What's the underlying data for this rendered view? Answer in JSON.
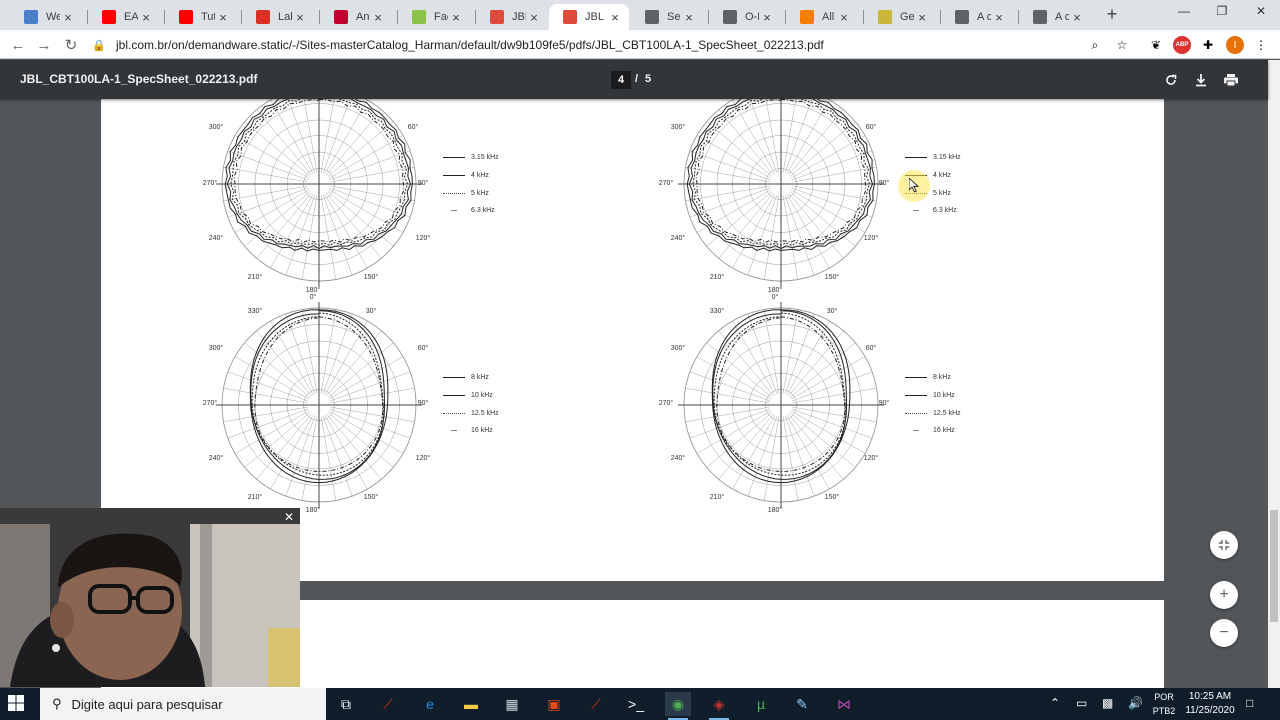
{
  "browser": {
    "tabs": [
      {
        "title": "Welti",
        "icon": "doc-icon",
        "color": "#4a7ec9"
      },
      {
        "title": "EASE",
        "icon": "youtube-icon",
        "color": "#ff0000"
      },
      {
        "title": "Tutor",
        "icon": "youtube-icon",
        "color": "#ff0000"
      },
      {
        "title": "Lab N",
        "icon": "red-shape-icon",
        "color": "#d93025"
      },
      {
        "title": "Angu",
        "icon": "angular-icon",
        "color": "#c3002f"
      },
      {
        "title": "Facts",
        "icon": "green-circle-icon",
        "color": "#8bc34a"
      },
      {
        "title": "JBL C",
        "icon": "pdf-icon",
        "color": "#e04a3a"
      },
      {
        "title": "JBL C",
        "icon": "pdf-icon",
        "color": "#e04a3a",
        "active": true
      },
      {
        "title": "Sem",
        "icon": "globe-icon",
        "color": "#5f6368"
      },
      {
        "title": "O-Lin",
        "icon": "globe-icon",
        "color": "#5f6368"
      },
      {
        "title": "All Sp",
        "icon": "blogger-icon",
        "color": "#f57d00"
      },
      {
        "title": "Gene",
        "icon": "shield-icon",
        "color": "#c9b73a"
      },
      {
        "title": "A col",
        "icon": "globe-icon",
        "color": "#5f6368"
      },
      {
        "title": "A col",
        "icon": "globe-icon",
        "color": "#5f6368"
      }
    ],
    "url": "jbl.com.br/on/demandware.static/-/Sites-masterCatalog_Harman/default/dw9b109fe5/pdfs/JBL_CBT100LA-1_SpecSheet_022213.pdf",
    "extensions": [
      {
        "icon": "zoom-icon",
        "glyph": "⌕"
      },
      {
        "icon": "star-icon",
        "glyph": "☆"
      },
      {
        "icon": "extension-leaf-icon",
        "glyph": "❦"
      },
      {
        "icon": "abp-icon",
        "glyph": "ABP"
      },
      {
        "icon": "puzzle-icon",
        "glyph": "✚"
      },
      {
        "icon": "profile-avatar-icon",
        "glyph": "I"
      },
      {
        "icon": "menu-dots-icon",
        "glyph": "⋮"
      }
    ]
  },
  "pdf": {
    "filename": "JBL_CBT100LA-1_SpecSheet_022213.pdf",
    "current_page": "4",
    "separator": "/",
    "total_pages": "5",
    "plots": [
      {
        "id": "top-left",
        "angle_labels": [
          "300°",
          "60°",
          "270°",
          "90°",
          "240°",
          "120°",
          "210°",
          "150°",
          "180°"
        ],
        "legend": [
          "3.15 kHz",
          "4 kHz",
          "5 kHz",
          "6.3 kHz"
        ]
      },
      {
        "id": "top-right",
        "angle_labels": [
          "300°",
          "60°",
          "270°",
          "90°",
          "240°",
          "120°",
          "210°",
          "150°",
          "180°"
        ],
        "legend": [
          "3.15 kHz",
          "4 kHz",
          "5 kHz",
          "6.3 kHz"
        ]
      },
      {
        "id": "bottom-left",
        "angle_labels": [
          "0°",
          "330°",
          "30°",
          "300°",
          "60°",
          "270°",
          "90°",
          "240°",
          "120°",
          "210°",
          "150°",
          "180°"
        ],
        "legend": [
          "8 kHz",
          "10 kHz",
          "12.5 kHz",
          "16 kHz"
        ]
      },
      {
        "id": "bottom-right",
        "angle_labels": [
          "0°",
          "330°",
          "30°",
          "300°",
          "60°",
          "270°",
          "90°",
          "240°",
          "120°",
          "210°",
          "150°",
          "180°"
        ],
        "legend": [
          "8 kHz",
          "10 kHz",
          "12.5 kHz",
          "16 kHz"
        ]
      }
    ]
  },
  "taskbar": {
    "search_placeholder": "Digite aqui para pesquisar",
    "language_line1": "POR",
    "language_line2": "PTB2",
    "time": "10:25 AM",
    "date": "11/25/2020",
    "apps": [
      {
        "icon": "task-view-icon",
        "glyph": "⧉"
      },
      {
        "icon": "acrobat-icon",
        "glyph": "⟋"
      },
      {
        "icon": "edge-icon",
        "glyph": "e"
      },
      {
        "icon": "file-explorer-icon",
        "glyph": "▬"
      },
      {
        "icon": "calculator-icon",
        "glyph": "▦"
      },
      {
        "icon": "intellij-icon",
        "glyph": "▣"
      },
      {
        "icon": "acrobat-icon",
        "glyph": "⟋"
      },
      {
        "icon": "terminal-icon",
        "glyph": ">_"
      },
      {
        "icon": "chrome-icon",
        "glyph": "◉"
      },
      {
        "icon": "sketchup-icon",
        "glyph": "◈"
      },
      {
        "icon": "utorrent-icon",
        "glyph": "µ"
      },
      {
        "icon": "notepad-icon",
        "glyph": "✎"
      },
      {
        "icon": "visual-studio-icon",
        "glyph": "⋈"
      }
    ]
  },
  "colors": {
    "pdf_background": "#525659",
    "pdf_toolbar": "#323639",
    "taskbar": "#101e2b",
    "tab_strip": "#dee1e6"
  }
}
